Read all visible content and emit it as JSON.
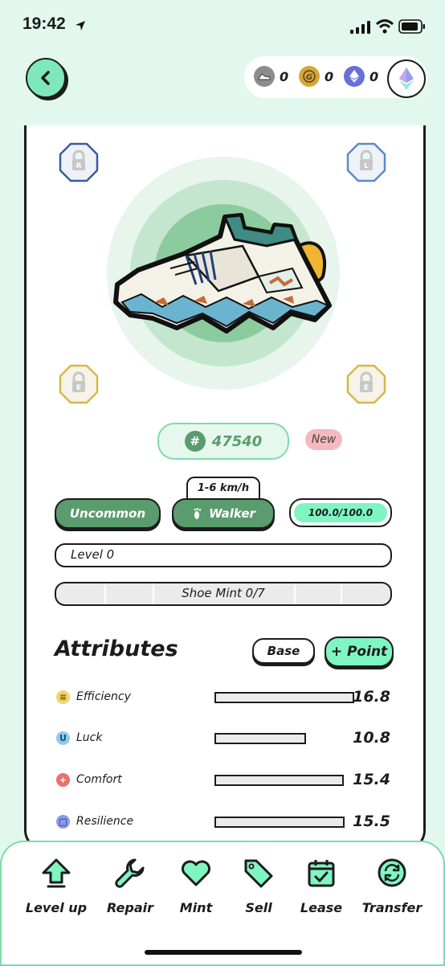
{
  "status_bar": {
    "time": "19:42"
  },
  "balances": [
    {
      "icon": "shoe-token-icon",
      "value": "0",
      "color": "#8c8c8c"
    },
    {
      "icon": "gst-coin-icon",
      "value": "0",
      "color": "#d6a63a"
    },
    {
      "icon": "eth-icon",
      "value": "0",
      "color": "#6a70d6"
    }
  ],
  "sneaker": {
    "id": "47540",
    "id_prefix": "#",
    "badge": "New",
    "speed_range": "1-6 km/h",
    "rarity": "Uncommon",
    "type": "Walker",
    "durability": "100.0/100.0",
    "durability_fraction": 1.0,
    "level": "Level 0",
    "shoe_mint": "Shoe Mint 0/7",
    "gem_sockets": [
      {
        "name": "socket-top-left",
        "letter": "R",
        "color": "#3a5aa0"
      },
      {
        "name": "socket-top-right",
        "letter": "L",
        "color": "#5a8ac8"
      },
      {
        "name": "socket-bottom-left",
        "letter": "E",
        "color": "#d6b84a"
      },
      {
        "name": "socket-bottom-right",
        "letter": "E",
        "color": "#d6b84a"
      }
    ]
  },
  "attributes": {
    "title": "Attributes",
    "base_label": "Base",
    "point_label": "+ Point",
    "items": [
      {
        "name": "Efficiency",
        "value": "16.8",
        "fraction": 0.99,
        "icon": "efficiency-icon",
        "color": "#f3d36b"
      },
      {
        "name": "Luck",
        "value": "10.8",
        "fraction": 0.64,
        "icon": "luck-icon",
        "color": "#8fcbee"
      },
      {
        "name": "Comfort",
        "value": "15.4",
        "fraction": 0.91,
        "icon": "comfort-icon",
        "color": "#ec6e6e"
      },
      {
        "name": "Resilience",
        "value": "15.5",
        "fraction": 0.92,
        "icon": "resilience-icon",
        "color": "#8a9ae8"
      }
    ]
  },
  "actions": [
    {
      "label": "Level up",
      "icon": "level-up-arrow-icon"
    },
    {
      "label": "Repair",
      "icon": "wrench-icon"
    },
    {
      "label": "Mint",
      "icon": "heart-icon"
    },
    {
      "label": "Sell",
      "icon": "price-tag-icon"
    },
    {
      "label": "Lease",
      "icon": "calendar-check-icon"
    },
    {
      "label": "Transfer",
      "icon": "transfer-arrows-icon"
    }
  ],
  "colors": {
    "accent": "#7ff5c2",
    "green": "#5a9c6d",
    "background": "#e2f8ee"
  }
}
